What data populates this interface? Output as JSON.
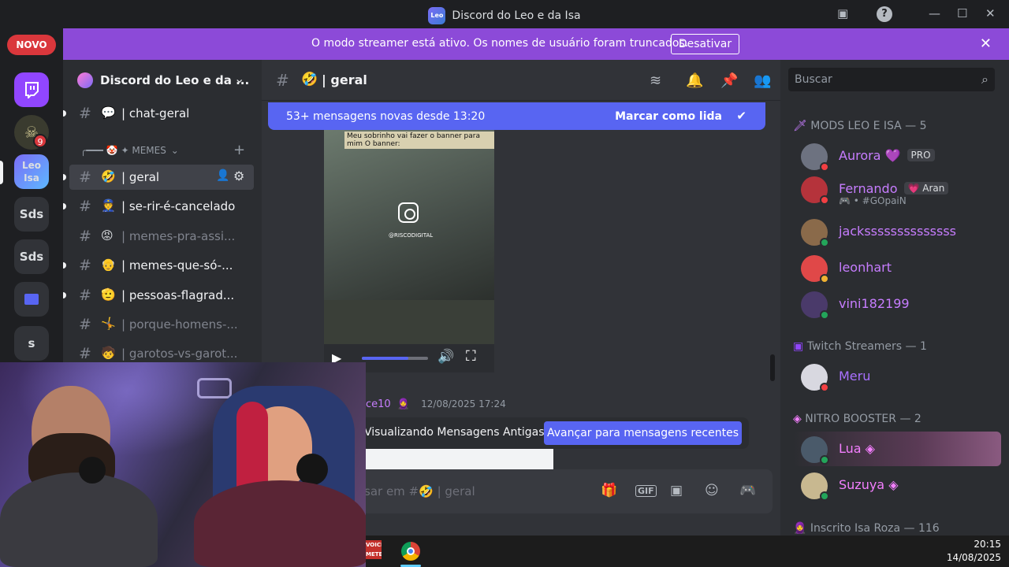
{
  "window": {
    "title": "Discord do Leo e da Isa",
    "app_logo": "Leo",
    "controls": {
      "screen_icon": "▣",
      "help": "?",
      "minimize": "—",
      "maximize": "☐",
      "close": "✕"
    }
  },
  "streamer_banner": {
    "text": "O modo streamer está ativo. Os nomes de usuário foram truncados.",
    "button": "Desativar",
    "close": "✕"
  },
  "server_rail": {
    "novo_label": "NOVO",
    "servers": [
      {
        "label": "",
        "icon": "twitch-icon"
      },
      {
        "label": "",
        "badge": "9"
      },
      {
        "label": "Leo Isa"
      },
      {
        "label": "Sds"
      },
      {
        "label": "Sds"
      },
      {
        "label": "",
        "icon": "folder-icon"
      },
      {
        "label": "s"
      }
    ]
  },
  "sidebar": {
    "server_name": "Discord do Leo e da ...",
    "chevron": "⌄",
    "category": "MEMES",
    "category_prefix": "╭━━━ 🤡 ✦",
    "channels": [
      {
        "emoji": "💬",
        "label": "| chat-geral",
        "muted": false
      },
      {
        "emoji": "🤣",
        "label": "| geral",
        "active": true
      },
      {
        "emoji": "👮",
        "label": "| se-rir-é-cancelado"
      },
      {
        "emoji": "😡",
        "label": "| memes-pra-assi...",
        "muted": true
      },
      {
        "emoji": "👴",
        "label": "| memes-que-só-..."
      },
      {
        "emoji": "🫡",
        "label": "| pessoas-flagrad..."
      },
      {
        "emoji": "🤸",
        "label": "| porque-homens-...",
        "muted": true
      },
      {
        "emoji": "🧒",
        "label": "| garotos-vs-garot...",
        "muted": true
      }
    ]
  },
  "chat": {
    "channel_emoji": "🤣",
    "channel_name": "| geral",
    "new_messages": "53+ mensagens novas desde 13:20",
    "mark_read": "Marcar como lida",
    "video_caption": "Meu sobrinho vai fazer o banner para mim  O banner:",
    "video_handle": "@RISCODIGITAL",
    "video_progress": 0.7,
    "msg_user": "ce10",
    "msg_time": "12/08/2025 17:24",
    "old_messages": "Visualizando Mensagens Antigas",
    "jump_button": "Avançar para mensagens recentes",
    "composer_placeholder": "sar em #🤣 | geral",
    "gif_label": "GIF"
  },
  "search": {
    "placeholder": "Buscar"
  },
  "members": {
    "groups": [
      {
        "title": "MODS LEO E ISA — 5"
      },
      {
        "title": "Twitch Streamers — 1"
      },
      {
        "title": "NITRO BOOSTER — 2"
      },
      {
        "title": "Inscrito Isa Roza — 116"
      }
    ],
    "list": [
      {
        "name": "Aurora",
        "extra": "💜",
        "tag": "PRO",
        "color": "#c77dff",
        "status": "#f23f43"
      },
      {
        "name": "Fernando",
        "tag": "💗 Aran",
        "sub": "🎮 • #GOpaiN",
        "color": "#c77dff",
        "status": "#f23f43"
      },
      {
        "name": "jackssssssssssssss",
        "color": "#c77dff",
        "status": "#23a55a"
      },
      {
        "name": "leonhart",
        "color": "#c77dff",
        "status": "#f0b232"
      },
      {
        "name": "vini182199",
        "color": "#c77dff",
        "status": "#23a55a"
      },
      {
        "name": "Meru",
        "color": "#a970ff",
        "status": "#f23f43"
      },
      {
        "name": "Lua",
        "extra": "◈",
        "color": "#f47fff",
        "status": "#23a55a"
      },
      {
        "name": "Suzuya",
        "extra": "◈",
        "color": "#f47fff",
        "status": "#23a55a"
      }
    ]
  },
  "taskbar": {
    "voice_label": "VOICE METER",
    "time": "20:15",
    "date": "14/08/2025"
  },
  "colors": {
    "streamer_bar": "#8c4ad8",
    "accent": "#5865f2",
    "mod_name": "#c77dff"
  }
}
